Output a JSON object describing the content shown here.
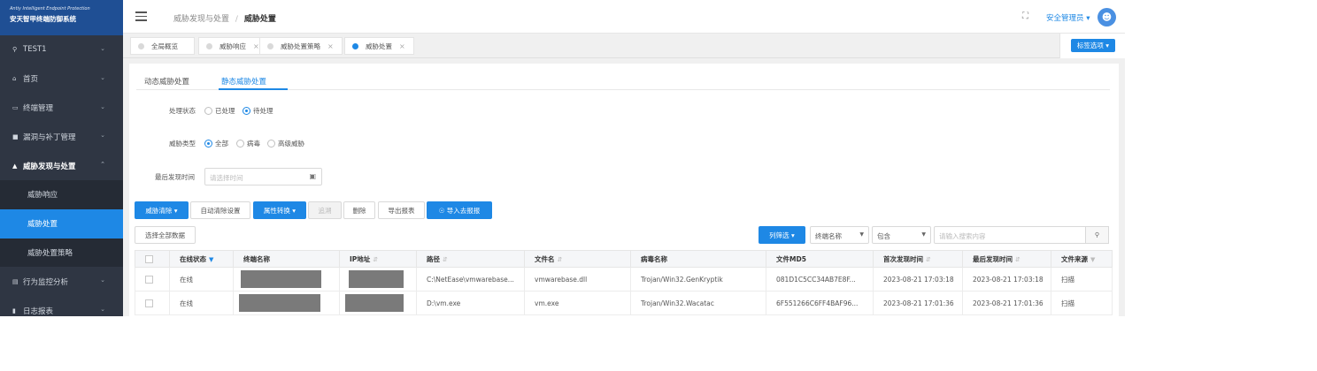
{
  "logo": {
    "en": "Antiy Intelligent Endpoint Protection",
    "cn": "安天智甲终端防御系统"
  },
  "sidebar": {
    "items": [
      {
        "label": "TEST1",
        "icon": "location-pin-icon"
      },
      {
        "label": "首页",
        "icon": "home-icon"
      },
      {
        "label": "终端管理",
        "icon": "monitor-icon"
      },
      {
        "label": "漏洞与补丁管理",
        "icon": "patch-icon"
      },
      {
        "label": "威胁发现与处置",
        "icon": "warning-icon"
      },
      {
        "label": "威胁响应"
      },
      {
        "label": "威胁处置"
      },
      {
        "label": "威胁处置策略"
      },
      {
        "label": "行为监控分析",
        "icon": "behavior-icon"
      },
      {
        "label": "日志报表",
        "icon": "chart-icon"
      }
    ]
  },
  "header": {
    "breadcrumb_parent": "威胁发现与处置",
    "breadcrumb_sep": "/",
    "breadcrumb_current": "威胁处置",
    "user": "安全管理员 ▾"
  },
  "tabs": [
    {
      "label": "全局概览"
    },
    {
      "label": "威胁响应",
      "close": "×"
    },
    {
      "label": "威胁处置策略",
      "close": "×"
    },
    {
      "label": "威胁处置",
      "close": "×"
    }
  ],
  "tab_options_label": "标签选项 ▾",
  "subtabs": [
    "动态威胁处置",
    "静态威胁处置"
  ],
  "form": {
    "status_label": "处理状态",
    "status_options": [
      "已处理",
      "待处理"
    ],
    "type_label": "威胁类型",
    "type_options": [
      "全部",
      "病毒",
      "高级威胁"
    ],
    "last_found_label": "最后发现时间",
    "date_placeholder": "请选择时间"
  },
  "toolbar": {
    "clear": "威胁清除 ▾",
    "auto_clear": "自动清除设置",
    "attr_convert": "属性转换 ▾",
    "trace": "追溯",
    "delete": "删除",
    "export": "导出报表",
    "import_report": "导入去报报",
    "select_all": "选择全部数据",
    "col_filter": "列筛选 ▾",
    "field_select": "终端名称",
    "op_select": "包含",
    "search_placeholder": "请输入搜索内容",
    "search_icon": "⚲"
  },
  "table": {
    "headers": [
      "在线状态",
      "终端名称",
      "IP地址",
      "路径",
      "文件名",
      "病毒名称",
      "文件MD5",
      "首次发现时间",
      "最后发现时间",
      "文件来源"
    ],
    "rows": [
      {
        "status": "在线",
        "path": "C:\\NetEase\\vmwarebase...",
        "file": "vmwarebase.dll",
        "virus": "Trojan/Win32.GenKryptik",
        "md5": "081D1C5CC34AB7E8F...",
        "first": "2023-08-21 17:03:18",
        "last": "2023-08-21 17:03:18",
        "source": "扫描"
      },
      {
        "status": "在线",
        "path": "D:\\vm.exe",
        "file": "vm.exe",
        "virus": "Trojan/Win32.Wacatac",
        "md5": "6F551266C6FF4BAF96...",
        "first": "2023-08-21 17:01:36",
        "last": "2023-08-21 17:01:36",
        "source": "扫描"
      }
    ]
  },
  "colors": {
    "accent": "#1e88e5",
    "sidebar": "#2f3643",
    "logo_bg": "#1f4f94",
    "online": "#4caf50"
  }
}
